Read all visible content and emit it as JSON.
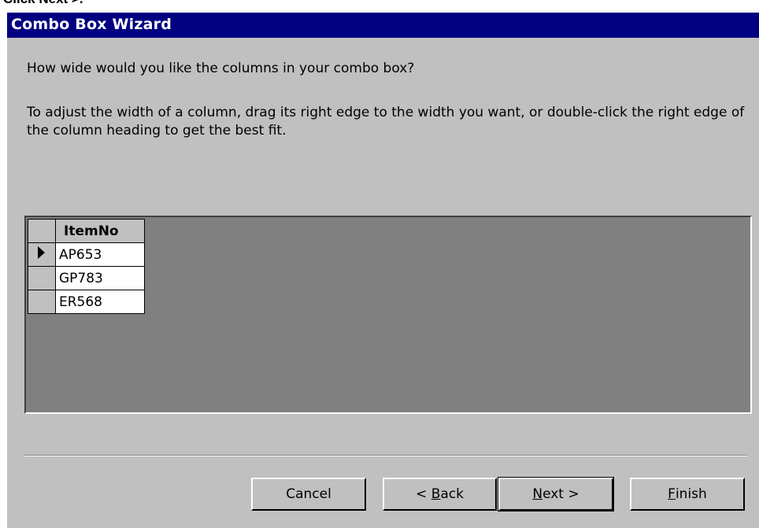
{
  "top_caption": "Click Next >.",
  "window": {
    "title": "Combo Box Wizard"
  },
  "prompt": "How wide would you like the columns in your combo box?",
  "instructions": "To adjust the width of a column, drag its right edge to the width you want, or double-click the right edge of the column heading to get the best fit.",
  "grid": {
    "column_header": "ItemNo",
    "rows": [
      "AP653",
      "GP783",
      "ER568"
    ],
    "current_row_indicator": "record-arrow-icon"
  },
  "buttons": {
    "cancel": "Cancel",
    "back_prefix": "< ",
    "back_mnemonic": "B",
    "back_rest": "ack",
    "next_mnemonic": "N",
    "next_rest": "ext >",
    "finish_mnemonic": "F",
    "finish_rest": "inish"
  },
  "colors": {
    "titlebar": "#000080",
    "dialog_bg": "#c0c0c0",
    "preview_bg": "#808080"
  }
}
